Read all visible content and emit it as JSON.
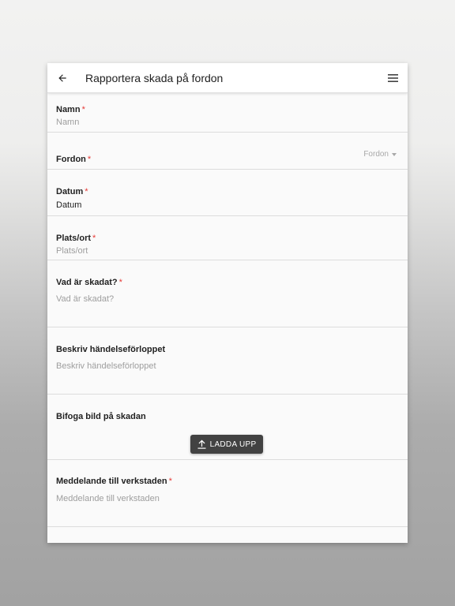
{
  "header": {
    "title": "Rapportera skada på fordon",
    "back_icon": "arrow-left-icon",
    "menu_icon": "hamburger-menu-icon"
  },
  "form": {
    "required_mark": "*",
    "name": {
      "label": "Namn",
      "placeholder": "Namn",
      "required": true
    },
    "vehicle": {
      "label": "Fordon",
      "selected": "Fordon",
      "required": true
    },
    "date": {
      "label": "Datum",
      "value": "Datum",
      "required": true
    },
    "location": {
      "label": "Plats/ort",
      "placeholder": "Plats/ort",
      "required": false
    },
    "damage": {
      "label": "Vad är skadat?",
      "placeholder": "Vad är skadat?",
      "required": true
    },
    "description": {
      "label": "Beskriv händelseförloppet",
      "placeholder": "Beskriv händelseförloppet",
      "required": false
    },
    "photo": {
      "label": "Bifoga bild på skadan",
      "button_label": "LADDA UPP",
      "button_icon": "upload-icon"
    },
    "message": {
      "label": "Meddelande till verkstaden",
      "placeholder": "Meddelande till verkstaden",
      "required": true
    }
  },
  "colors": {
    "required": "#e53935",
    "button_bg": "#424242",
    "placeholder": "#9e9e9e"
  }
}
